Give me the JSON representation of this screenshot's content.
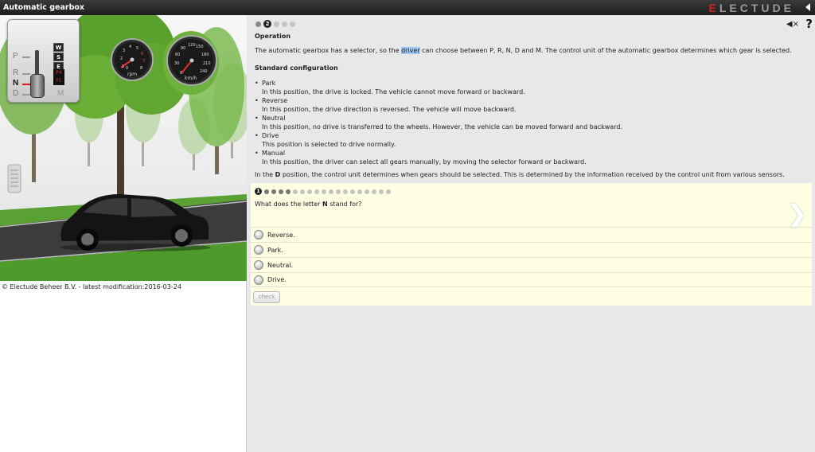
{
  "topbar": {
    "title": "Automatic gearbox",
    "logo_first": "E",
    "logo_rest": "LECTUDE"
  },
  "left": {
    "copyright": "© Electude Beheer B.V. - latest modification:2016-03-24",
    "selector": {
      "positions": [
        "P",
        "R",
        "N",
        "D",
        "M"
      ],
      "active": "N",
      "modes": [
        "W",
        "S",
        "E"
      ],
      "gear_display": [
        "P4",
        "F1"
      ]
    },
    "rpm_gauge": {
      "label": "rpm",
      "ticks": [
        "1",
        "2",
        "3",
        "4",
        "5",
        "6",
        "7",
        "8",
        "0"
      ]
    },
    "speed_gauge": {
      "label": "km/h",
      "ticks": [
        "0",
        "30",
        "60",
        "90",
        "120",
        "150",
        "180",
        "210",
        "240"
      ]
    }
  },
  "right": {
    "pager": {
      "current": "2",
      "total": 5
    },
    "section_title": "Operation",
    "intro_before": "The automatic gearbox has a selector, so the ",
    "intro_highlight": "driver",
    "intro_after": " can choose between P, R, N, D and M. The control unit of the automatic gearbox determines which gear is selected.",
    "config_title": "Standard configuration",
    "config_items": [
      {
        "name": "Park",
        "desc": "In this position, the drive is locked. The vehicle cannot move forward or backward."
      },
      {
        "name": "Reverse",
        "desc": "In this position, the drive direction is reversed. The vehicle will move backward."
      },
      {
        "name": "Neutral",
        "desc": "In this position, no drive is transferred to the wheels. However, the vehicle can be moved forward and backward."
      },
      {
        "name": "Drive",
        "desc": "This position is selected to drive normally."
      },
      {
        "name": "Manual",
        "desc": "In this position, the driver can select all gears manually, by moving the selector forward or backward."
      }
    ],
    "footer_before": "In the ",
    "footer_bold": "D",
    "footer_after": " position, the control unit determines when gears should be selected. This is determined by the information received by the control unit from various sensors."
  },
  "question": {
    "pager": {
      "current": "1",
      "total": 19
    },
    "text_before": "What does the letter ",
    "text_bold": "N",
    "text_after": " stand for?",
    "options": [
      "Reverse.",
      "Park.",
      "Neutral.",
      "Drive."
    ],
    "check_label": "check"
  },
  "colors": {
    "accent_red": "#d62020",
    "highlight": "#9fc7f2",
    "question_bg": "#fefee3"
  }
}
